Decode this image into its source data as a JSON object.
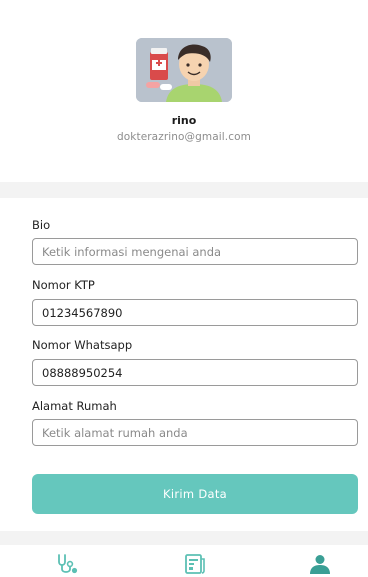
{
  "profile": {
    "name": "rino",
    "email": "dokterazrino@gmail.com"
  },
  "form": {
    "bio": {
      "label": "Bio",
      "placeholder": "Ketik informasi mengenai anda",
      "value": ""
    },
    "ktp": {
      "label": "Nomor KTP",
      "placeholder": "",
      "value": "01234567890"
    },
    "whatsapp": {
      "label": "Nomor Whatsapp",
      "placeholder": "",
      "value": "08888950254"
    },
    "address": {
      "label": "Alamat Rumah",
      "placeholder": "Ketik alamat rumah anda",
      "value": ""
    },
    "submit_label": "Kirim Data"
  },
  "bottom_nav": {
    "items": [
      {
        "icon": "stethoscope-icon",
        "active": false
      },
      {
        "icon": "document-icon",
        "active": false
      },
      {
        "icon": "person-icon",
        "active": true
      }
    ]
  },
  "colors": {
    "accent": "#65c7bd",
    "nav_icon": "#5cc0b4",
    "nav_icon_active": "#3a9f95"
  }
}
